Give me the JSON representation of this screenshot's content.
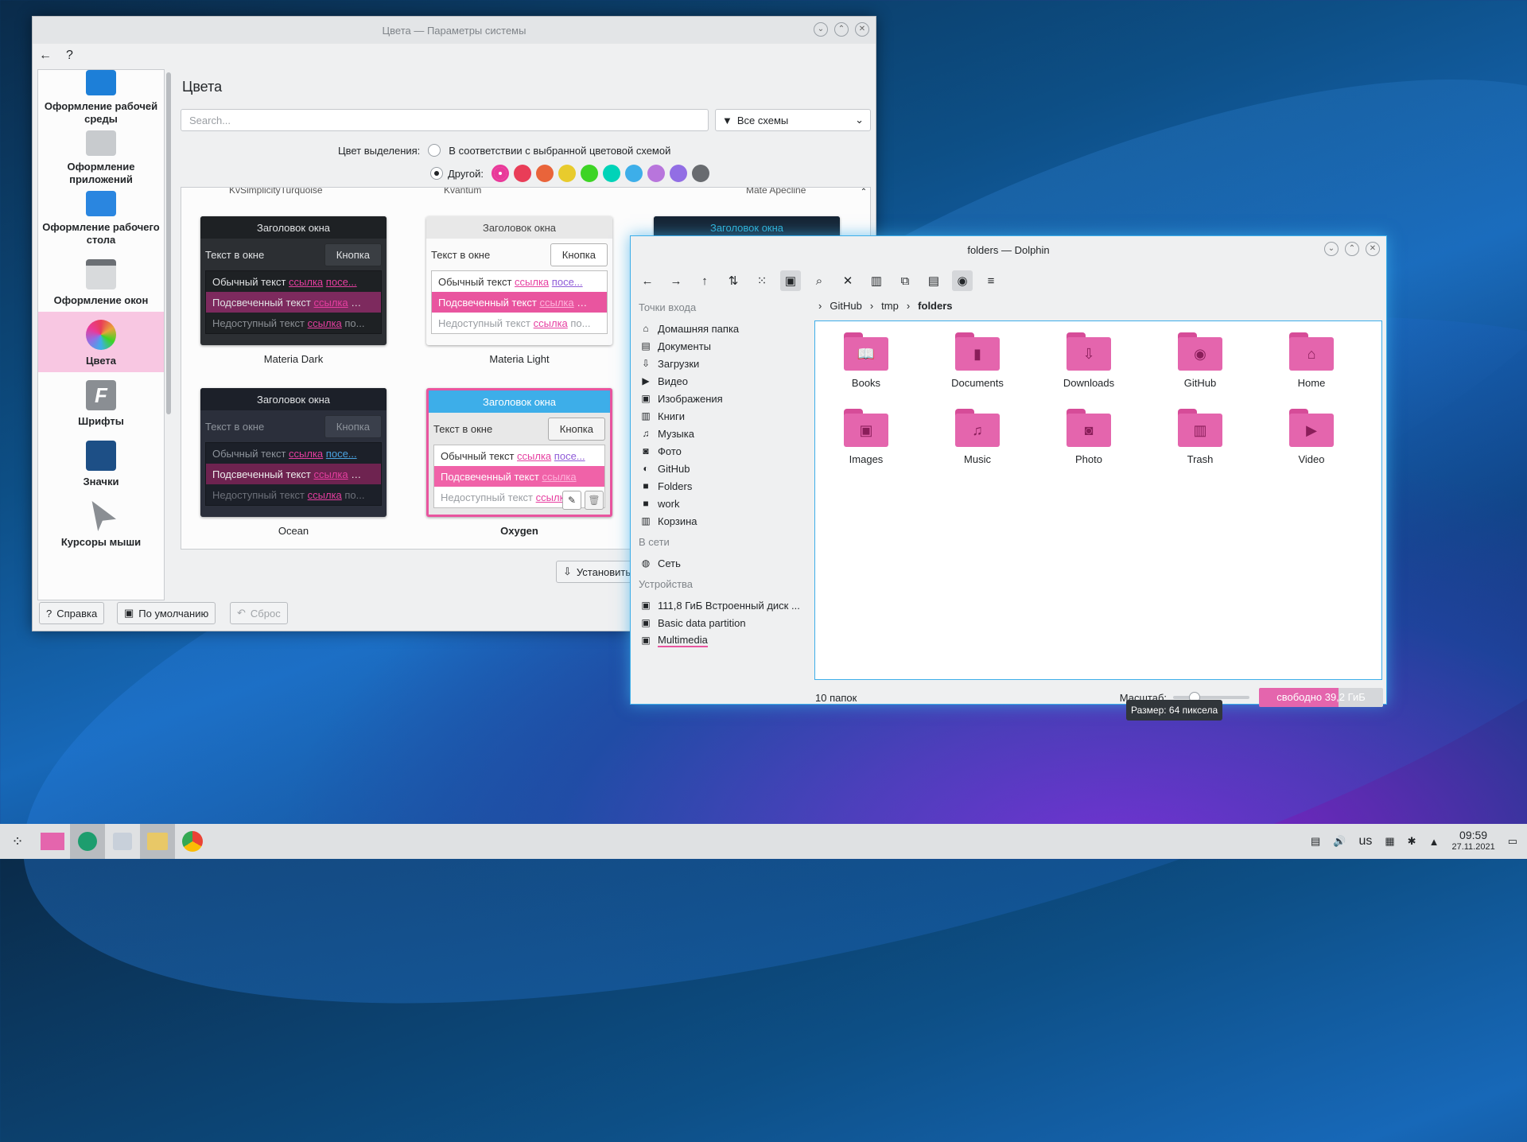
{
  "settings": {
    "title": "Цвета — Параметры системы",
    "back": "←",
    "help": "?",
    "page_title": "Цвета",
    "search_placeholder": "Search...",
    "filter": "Все схемы",
    "accent_label": "Цвет выделения:",
    "accent_opt1": "В соответствии с выбранной цветовой схемой",
    "accent_opt2": "Другой:",
    "swatches": [
      "#e93a9a",
      "#e93d58",
      "#e9643a",
      "#e8cb2d",
      "#3dd425",
      "#00d3b8",
      "#3daee9",
      "#b875dc",
      "#926ee4",
      "#686b6f"
    ],
    "partial_names": [
      "KvSimplicityTurquoise",
      "Kvantum",
      "Mate Apecline"
    ],
    "sidebar": [
      {
        "label": "Оформление рабочей среды",
        "icon": "desktop-theme-icon"
      },
      {
        "label": "Оформление приложений",
        "icon": "app-style-icon"
      },
      {
        "label": "Оформление рабочего стола",
        "icon": "workspace-icon"
      },
      {
        "label": "Оформление окон",
        "icon": "window-decor-icon"
      },
      {
        "label": "Цвета",
        "icon": "colors-icon"
      },
      {
        "label": "Шрифты",
        "icon": "fonts-icon"
      },
      {
        "label": "Значки",
        "icon": "icons-icon"
      },
      {
        "label": "Курсоры мыши",
        "icon": "cursor-icon"
      }
    ],
    "preview": {
      "window_title": "Заголовок окна",
      "window_text": "Текст в окне",
      "button": "Кнопка",
      "normal": "Обычный текст",
      "highlight": "Подсвеченный текст",
      "disabled": "Недоступный текст",
      "link": "ссылка",
      "visited": "посе..."
    },
    "schemes": [
      "Materia Dark",
      "Materia Light",
      "Ocean",
      "Oxygen"
    ],
    "install": "Установить и",
    "help_btn": "Справка",
    "defaults": "По умолчанию",
    "reset": "Сброс"
  },
  "dolphin": {
    "title": "folders — Dolphin",
    "places_header": "Точки входа",
    "places": [
      "Домашняя папка",
      "Документы",
      "Загрузки",
      "Видео",
      "Изображения",
      "Книги",
      "Музыка",
      "Фото",
      "GitHub",
      "Folders",
      "work",
      "Корзина"
    ],
    "network_header": "В сети",
    "network": [
      "Сеть"
    ],
    "devices_header": "Устройства",
    "devices": [
      "111,8 ГиБ Встроенный диск ...",
      "Basic data partition",
      "Multimedia"
    ],
    "breadcrumb": [
      "GitHub",
      "tmp",
      "folders"
    ],
    "files": [
      {
        "name": "Books",
        "icon": "book-icon"
      },
      {
        "name": "Documents",
        "icon": "document-icon"
      },
      {
        "name": "Downloads",
        "icon": "download-icon"
      },
      {
        "name": "GitHub",
        "icon": "github-icon"
      },
      {
        "name": "Home",
        "icon": "home-icon"
      },
      {
        "name": "Images",
        "icon": "image-icon"
      },
      {
        "name": "Music",
        "icon": "music-icon"
      },
      {
        "name": "Photo",
        "icon": "camera-icon"
      },
      {
        "name": "Trash",
        "icon": "trash-icon"
      },
      {
        "name": "Video",
        "icon": "video-icon"
      }
    ],
    "count": "10 папок",
    "zoom_label": "Масштаб:",
    "free": "свободно 39,2 ГиБ",
    "tooltip": "Размер: 64 пиксела"
  },
  "taskbar": {
    "keyboard": "us",
    "time": "09:59",
    "date": "27.11.2021"
  }
}
